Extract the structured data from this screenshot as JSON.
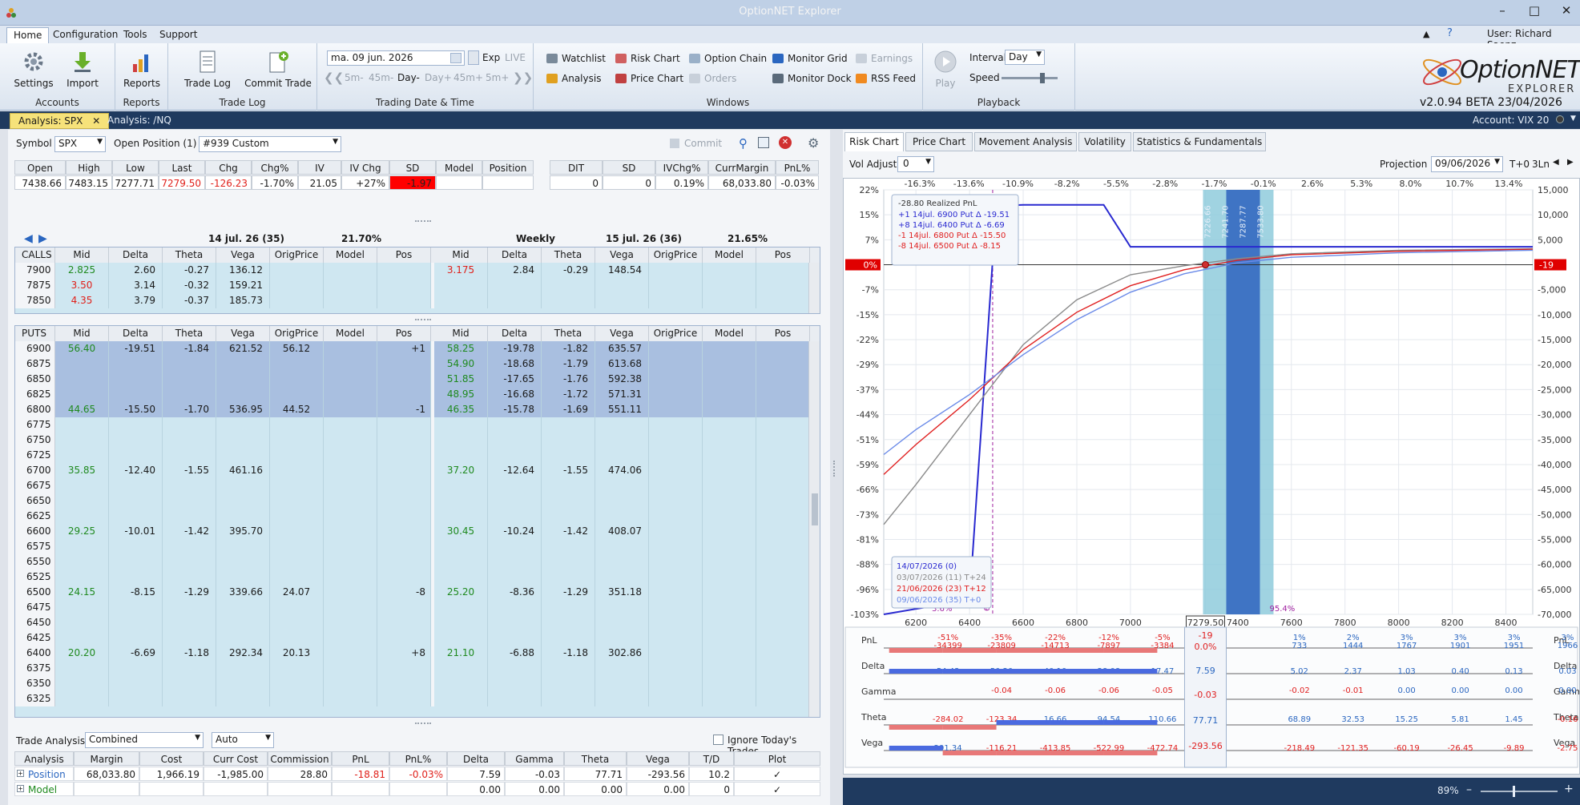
{
  "window": {
    "title": "OptionNET Explorer",
    "user": "User: Richard Saenz"
  },
  "menu": [
    "Home",
    "Configuration",
    "Tools",
    "Support"
  ],
  "ribbon": {
    "accounts": {
      "label": "Accounts",
      "settings": "Settings",
      "import": "Import"
    },
    "reports": {
      "label": "Reports",
      "reports": "Reports"
    },
    "tradelog": {
      "label": "Trade Log",
      "trade_log": "Trade Log",
      "commit_trade": "Commit Trade"
    },
    "date": {
      "label": "Trading Date & Time",
      "date_value": "ma. 09 jun. 2026",
      "exp": "Exp",
      "live": "LIVE",
      "steps": [
        "5m-",
        "45m-",
        "Day-",
        "Day+",
        "45m+",
        "5m+"
      ]
    },
    "windows": {
      "label": "Windows",
      "watchlist": "Watchlist",
      "analysis": "Analysis",
      "risk_chart": "Risk Chart",
      "price_chart": "Price Chart",
      "option_chain": "Option Chain",
      "orders": "Orders",
      "monitor_grid": "Monitor Grid",
      "monitor_dock": "Monitor Dock",
      "earnings": "Earnings",
      "rss_feed": "RSS Feed"
    },
    "playback": {
      "label": "Playback",
      "play": "Play",
      "interval_label": "Interval",
      "interval_value": "Day",
      "speed_label": "Speed"
    },
    "brand": {
      "name": "OptionNET",
      "sub": "EXPLORER",
      "version": "v2.0.94 BETA 23/04/2026"
    }
  },
  "doc_tabs": [
    "Analysis: SPX",
    "Analysis: /NQ"
  ],
  "account": "Account: VIX 20",
  "symbol_bar": {
    "symbol_label": "Symbol",
    "symbol": "SPX",
    "open_pos": "Open Position (1)",
    "custom": "#939 Custom",
    "commit": "Commit"
  },
  "quote": {
    "headers": [
      "Open",
      "High",
      "Low",
      "Last",
      "Chg",
      "Chg%",
      "IV",
      "IV Chg",
      "SD",
      "Model",
      "Position"
    ],
    "values": [
      "7438.66",
      "7483.15",
      "7277.71",
      "7279.50",
      "-126.23",
      "-1.70%",
      "21.05",
      "+27%",
      "-1.97",
      "",
      ""
    ],
    "headers2": [
      "DIT",
      "SD",
      "IVChg%",
      "CurrMargin",
      "PnL%"
    ],
    "values2": [
      "0",
      "0",
      "0.19%",
      "68,033.80",
      "-0.03%"
    ]
  },
  "chain": {
    "left_title": "14 jul. 26 (35)",
    "left_iv": "21.70%",
    "right_weekly": "Weekly",
    "right_title": "15 jul. 26 (36)",
    "right_iv": "21.65%",
    "col_headers": [
      "Mid",
      "Delta",
      "Theta",
      "Vega",
      "OrigPrice",
      "Model",
      "Pos"
    ],
    "calls_label": "CALLS",
    "puts_label": "PUTS",
    "calls": [
      {
        "strike": "7900",
        "l": [
          "2.825",
          "2.60",
          "-0.27",
          "136.12",
          "",
          "",
          ""
        ],
        "r": [
          "3.175",
          "2.84",
          "-0.29",
          "148.54",
          "",
          "",
          ""
        ],
        "lc": "green",
        "rc": "red"
      },
      {
        "strike": "7875",
        "l": [
          "3.50",
          "3.14",
          "-0.32",
          "159.21",
          "",
          "",
          ""
        ],
        "r": [
          "",
          "",
          "",
          "",
          "",
          "",
          ""
        ],
        "lc": "red",
        "rc": ""
      },
      {
        "strike": "7850",
        "l": [
          "4.35",
          "3.79",
          "-0.37",
          "185.73",
          "",
          "",
          ""
        ],
        "r": [
          "",
          "",
          "",
          "",
          "",
          "",
          ""
        ],
        "lc": "red",
        "rc": ""
      }
    ],
    "puts": [
      {
        "strike": "6900",
        "l": [
          "56.40",
          "-19.51",
          "-1.84",
          "621.52",
          "56.12",
          "",
          "+1"
        ],
        "r": [
          "58.25",
          "-19.78",
          "-1.82",
          "635.57",
          "",
          "",
          ""
        ],
        "sel": true
      },
      {
        "strike": "6875",
        "l": [
          "",
          "",
          "",
          "",
          "",
          "",
          ""
        ],
        "r": [
          "54.90",
          "-18.68",
          "-1.79",
          "613.68",
          "",
          "",
          ""
        ],
        "sel": true
      },
      {
        "strike": "6850",
        "l": [
          "",
          "",
          "",
          "",
          "",
          "",
          ""
        ],
        "r": [
          "51.85",
          "-17.65",
          "-1.76",
          "592.38",
          "",
          "",
          ""
        ],
        "sel": true
      },
      {
        "strike": "6825",
        "l": [
          "",
          "",
          "",
          "",
          "",
          "",
          ""
        ],
        "r": [
          "48.95",
          "-16.68",
          "-1.72",
          "571.31",
          "",
          "",
          ""
        ],
        "sel": true
      },
      {
        "strike": "6800",
        "l": [
          "44.65",
          "-15.50",
          "-1.70",
          "536.95",
          "44.52",
          "",
          "-1"
        ],
        "r": [
          "46.35",
          "-15.78",
          "-1.69",
          "551.11",
          "",
          "",
          ""
        ],
        "sel": true
      },
      {
        "strike": "6775",
        "l": [
          "",
          "",
          "",
          "",
          "",
          "",
          ""
        ],
        "r": [
          "",
          "",
          "",
          "",
          "",
          "",
          ""
        ]
      },
      {
        "strike": "6750",
        "l": [
          "",
          "",
          "",
          "",
          "",
          "",
          ""
        ],
        "r": [
          "",
          "",
          "",
          "",
          "",
          "",
          ""
        ]
      },
      {
        "strike": "6725",
        "l": [
          "",
          "",
          "",
          "",
          "",
          "",
          ""
        ],
        "r": [
          "",
          "",
          "",
          "",
          "",
          "",
          ""
        ]
      },
      {
        "strike": "6700",
        "l": [
          "35.85",
          "-12.40",
          "-1.55",
          "461.16",
          "",
          "",
          ""
        ],
        "r": [
          "37.20",
          "-12.64",
          "-1.55",
          "474.06",
          "",
          "",
          ""
        ]
      },
      {
        "strike": "6675",
        "l": [
          "",
          "",
          "",
          "",
          "",
          "",
          ""
        ],
        "r": [
          "",
          "",
          "",
          "",
          "",
          "",
          ""
        ]
      },
      {
        "strike": "6650",
        "l": [
          "",
          "",
          "",
          "",
          "",
          "",
          ""
        ],
        "r": [
          "",
          "",
          "",
          "",
          "",
          "",
          ""
        ]
      },
      {
        "strike": "6625",
        "l": [
          "",
          "",
          "",
          "",
          "",
          "",
          ""
        ],
        "r": [
          "",
          "",
          "",
          "",
          "",
          "",
          ""
        ]
      },
      {
        "strike": "6600",
        "l": [
          "29.25",
          "-10.01",
          "-1.42",
          "395.70",
          "",
          "",
          ""
        ],
        "r": [
          "30.45",
          "-10.24",
          "-1.42",
          "408.07",
          "",
          "",
          ""
        ]
      },
      {
        "strike": "6575",
        "l": [
          "",
          "",
          "",
          "",
          "",
          "",
          ""
        ],
        "r": [
          "",
          "",
          "",
          "",
          "",
          "",
          ""
        ]
      },
      {
        "strike": "6550",
        "l": [
          "",
          "",
          "",
          "",
          "",
          "",
          ""
        ],
        "r": [
          "",
          "",
          "",
          "",
          "",
          "",
          ""
        ]
      },
      {
        "strike": "6525",
        "l": [
          "",
          "",
          "",
          "",
          "",
          "",
          ""
        ],
        "r": [
          "",
          "",
          "",
          "",
          "",
          "",
          ""
        ]
      },
      {
        "strike": "6500",
        "l": [
          "24.15",
          "-8.15",
          "-1.29",
          "339.66",
          "24.07",
          "",
          "-8"
        ],
        "r": [
          "25.20",
          "-8.36",
          "-1.29",
          "351.18",
          "",
          "",
          ""
        ]
      },
      {
        "strike": "6475",
        "l": [
          "",
          "",
          "",
          "",
          "",
          "",
          ""
        ],
        "r": [
          "",
          "",
          "",
          "",
          "",
          "",
          ""
        ]
      },
      {
        "strike": "6450",
        "l": [
          "",
          "",
          "",
          "",
          "",
          "",
          ""
        ],
        "r": [
          "",
          "",
          "",
          "",
          "",
          "",
          ""
        ]
      },
      {
        "strike": "6425",
        "l": [
          "",
          "",
          "",
          "",
          "",
          "",
          ""
        ],
        "r": [
          "",
          "",
          "",
          "",
          "",
          "",
          ""
        ]
      },
      {
        "strike": "6400",
        "l": [
          "20.20",
          "-6.69",
          "-1.18",
          "292.34",
          "20.13",
          "",
          "+8"
        ],
        "r": [
          "21.10",
          "-6.88",
          "-1.18",
          "302.86",
          "",
          "",
          ""
        ]
      },
      {
        "strike": "6375",
        "l": [
          "",
          "",
          "",
          "",
          "",
          "",
          ""
        ],
        "r": [
          "",
          "",
          "",
          "",
          "",
          "",
          ""
        ]
      },
      {
        "strike": "6350",
        "l": [
          "",
          "",
          "",
          "",
          "",
          "",
          ""
        ],
        "r": [
          "",
          "",
          "",
          "",
          "",
          "",
          ""
        ]
      },
      {
        "strike": "6325",
        "l": [
          "",
          "",
          "",
          "",
          "",
          "",
          ""
        ],
        "r": [
          "",
          "",
          "",
          "",
          "",
          "",
          ""
        ]
      }
    ]
  },
  "trade_analysis": {
    "label": "Trade Analysis",
    "mode": "Combined",
    "auto": "Auto",
    "ignore": "Ignore Today's Trades",
    "headers": [
      "Analysis",
      "Margin",
      "Cost",
      "Curr Cost",
      "Commission",
      "PnL",
      "PnL%",
      "Delta",
      "Gamma",
      "Theta",
      "Vega",
      "T/D",
      "Plot"
    ],
    "rows": [
      [
        "Position",
        "68,033.80",
        "1,966.19",
        "-1,985.00",
        "28.80",
        "-18.81",
        "-0.03%",
        "7.59",
        "-0.03",
        "77.71",
        "-293.56",
        "10.2",
        "✓"
      ],
      [
        "Model",
        "",
        "",
        "",
        "",
        "",
        "",
        "0.00",
        "0.00",
        "0.00",
        "0.00",
        "0",
        "✓"
      ]
    ]
  },
  "right_tabs": [
    "Risk Chart",
    "Price Chart",
    "Movement Analysis",
    "Volatility",
    "Statistics & Fundamentals"
  ],
  "risk_controls": {
    "vol_adjust": "Vol Adjust",
    "vol_value": "0",
    "projection": "Projection",
    "proj_date": "09/06/2026",
    "proj_t": "T+0",
    "proj_ln": "3Ln"
  },
  "chart_data": {
    "type": "line",
    "top_pct": [
      "-16.3%",
      "-13.6%",
      "-10.9%",
      "-8.2%",
      "-5.5%",
      "-2.8%",
      "-1.7%",
      "-0.1%",
      "2.6%",
      "5.3%",
      "8.0%",
      "10.7%",
      "13.4%"
    ],
    "left_pct": [
      "22%",
      "15%",
      "7%",
      "0%",
      "-7%",
      "-15%",
      "-22%",
      "-29%",
      "-37%",
      "-44%",
      "-51%",
      "-59%",
      "-66%",
      "-73%",
      "-81%",
      "-88%",
      "-96%",
      "-103%"
    ],
    "right_vals": [
      "15,000",
      "10,000",
      "5,000",
      "-19",
      "-5,000",
      "-10,000",
      "-15,000",
      "-20,000",
      "-25,000",
      "-30,000",
      "-35,000",
      "-40,000",
      "-45,000",
      "-50,000",
      "-55,000",
      "-60,000",
      "-65,000",
      "-70,000"
    ],
    "x_ticks": [
      "6200",
      "6400",
      "6600",
      "6800",
      "7000",
      "7279.50",
      "7400",
      "7600",
      "7800",
      "8000",
      "8200",
      "8400"
    ],
    "xlim": [
      6080,
      8500
    ],
    "ylim": [
      -70000,
      15000
    ],
    "current_price": 7279.5,
    "band_labels": [
      "7226.66",
      "7241.70",
      "7287.77",
      "7533.80"
    ],
    "markers": {
      "breakeven": "6486.17",
      "left_pct": "3.6%",
      "right_pct": "95.4%"
    },
    "legend": {
      "realized": "-28.80 Realized PnL",
      "legs": [
        "+1 14jul. 6900 Put Δ -19.51",
        "+8 14jul. 6400 Put Δ -6.69",
        "-1 14jul. 6800 Put Δ -15.50",
        "-8 14jul. 6500 Put Δ -8.15"
      ]
    },
    "dates": [
      "14/07/2026 (0)",
      "03/07/2026 (11) T+24",
      "21/06/2026 (23) T+12",
      "09/06/2026 (35) T+0"
    ],
    "series": [
      {
        "name": "14/07/2026 (0)",
        "color": "#2a2ad0",
        "points": [
          [
            6080,
            -70000
          ],
          [
            6300,
            -68000
          ],
          [
            6400,
            -67000
          ],
          [
            6500,
            11800
          ],
          [
            6600,
            12000
          ],
          [
            6800,
            12000
          ],
          [
            6900,
            12000
          ],
          [
            7000,
            3600
          ],
          [
            7200,
            3600
          ],
          [
            8500,
            3600
          ]
        ]
      },
      {
        "name": "03/07/2026 (11) T+24",
        "color": "#8a8a8a",
        "points": [
          [
            6080,
            -52000
          ],
          [
            6200,
            -44000
          ],
          [
            6400,
            -30000
          ],
          [
            6600,
            -16000
          ],
          [
            6800,
            -7000
          ],
          [
            7000,
            -2000
          ],
          [
            7200,
            -200
          ],
          [
            7400,
            1200
          ],
          [
            7600,
            2200
          ],
          [
            8000,
            2900
          ],
          [
            8500,
            3200
          ]
        ]
      },
      {
        "name": "21/06/2026 (23) T+12",
        "color": "#e02020",
        "points": [
          [
            6080,
            -42000
          ],
          [
            6200,
            -36000
          ],
          [
            6400,
            -27000
          ],
          [
            6600,
            -17000
          ],
          [
            6800,
            -9500
          ],
          [
            7000,
            -4200
          ],
          [
            7200,
            -1000
          ],
          [
            7400,
            900
          ],
          [
            7600,
            2000
          ],
          [
            8000,
            2700
          ],
          [
            8500,
            3100
          ]
        ]
      },
      {
        "name": "09/06/2026 (35) T+0",
        "color": "#6a8ae8",
        "points": [
          [
            6080,
            -38000
          ],
          [
            6200,
            -33000
          ],
          [
            6400,
            -26000
          ],
          [
            6600,
            -18000
          ],
          [
            6800,
            -11000
          ],
          [
            7000,
            -5500
          ],
          [
            7200,
            -1800
          ],
          [
            7400,
            400
          ],
          [
            7600,
            1500
          ],
          [
            8000,
            2400
          ],
          [
            8500,
            2900
          ]
        ]
      }
    ]
  },
  "greeks": {
    "labels": [
      "PnL",
      "Delta",
      "Gamma",
      "Theta",
      "Vega"
    ],
    "current": {
      "pnl": "-19",
      "pnl_pct": "0.0%",
      "delta": "7.59",
      "gamma": "-0.03",
      "theta": "77.71",
      "vega": "-293.56"
    },
    "pnl_pct": [
      "-51%",
      "-35%",
      "-22%",
      "-12%",
      "-5%",
      "",
      "",
      "1%",
      "2%",
      "3%",
      "3%",
      "3%",
      "3%"
    ],
    "pnl_val": [
      "-34399",
      "-23809",
      "-14713",
      "-7897",
      "-3384",
      "",
      "",
      "733",
      "1444",
      "1767",
      "1901",
      "1951",
      "1966"
    ],
    "delta": [
      "54.43",
      "50.20",
      "40.10",
      "28.08",
      "17.47",
      "9.",
      "",
      "5.02",
      "2.37",
      "1.03",
      "0.40",
      "0.13",
      "0.03"
    ],
    "gamma": [
      "",
      "-0.04",
      "-0.06",
      "-0.06",
      "-0.05",
      "",
      "",
      "-0.02",
      "-0.01",
      "0.00",
      "0.00",
      "0.00",
      "0.00"
    ],
    "theta": [
      "-284.02",
      "-123.34",
      "16.66",
      "94.54",
      "110.66",
      "89",
      "",
      "68.89",
      "32.53",
      "15.25",
      "5.81",
      "1.45",
      "-0.16"
    ],
    "vega": [
      "291.34",
      "-116.21",
      "-413.85",
      "-522.99",
      "-472.74",
      "-34",
      "",
      "-218.49",
      "-121.35",
      "-60.19",
      "-26.45",
      "-9.89",
      "-2.75"
    ]
  },
  "zoom": "89%"
}
